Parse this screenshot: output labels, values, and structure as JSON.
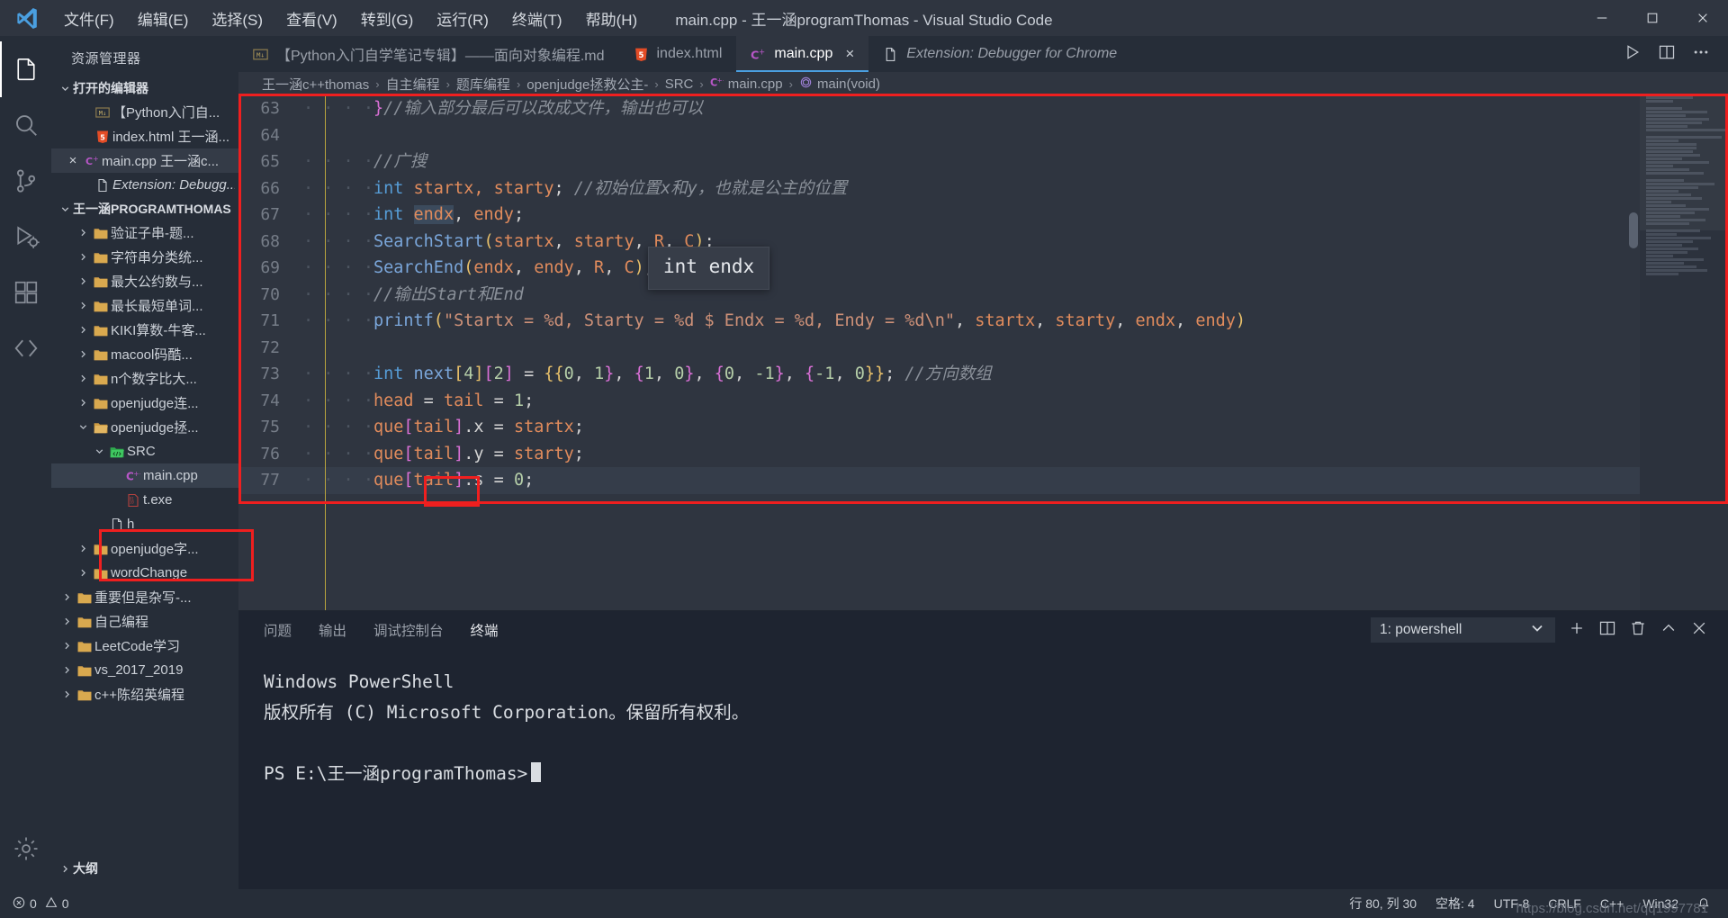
{
  "window": {
    "title": "main.cpp - 王一涵programThomas - Visual Studio Code",
    "logo_icon": "vscode-logo",
    "controls": {
      "minimize": "minimize-icon",
      "maximize": "maximize-icon",
      "close": "close-icon"
    }
  },
  "menubar": {
    "items": [
      {
        "label": "文件(F)",
        "name": "menu-file"
      },
      {
        "label": "编辑(E)",
        "name": "menu-edit"
      },
      {
        "label": "选择(S)",
        "name": "menu-selection"
      },
      {
        "label": "查看(V)",
        "name": "menu-view"
      },
      {
        "label": "转到(G)",
        "name": "menu-go"
      },
      {
        "label": "运行(R)",
        "name": "menu-run"
      },
      {
        "label": "终端(T)",
        "name": "menu-terminal"
      },
      {
        "label": "帮助(H)",
        "name": "menu-help"
      }
    ]
  },
  "activitybar": {
    "items": [
      {
        "icon": "explorer-icon",
        "active": true
      },
      {
        "icon": "search-icon",
        "active": false
      },
      {
        "icon": "source-control-icon",
        "active": false
      },
      {
        "icon": "run-and-debug-icon",
        "active": false
      },
      {
        "icon": "extensions-icon",
        "active": false
      },
      {
        "icon": "remote-explorer-icon",
        "active": false
      }
    ],
    "bottom": [
      {
        "icon": "gear-icon"
      }
    ]
  },
  "sidebar": {
    "title": "资源管理器",
    "open_editors": {
      "label": "打开的编辑器",
      "items": [
        {
          "name": "open-editor-python-md",
          "icon": "markdown-icon",
          "label": "【Python入门自...",
          "dirty": false,
          "active": false
        },
        {
          "name": "open-editor-index-html",
          "icon": "html-icon",
          "label": "index.html 王一涵...",
          "active": false
        },
        {
          "name": "open-editor-main-cpp",
          "icon": "cpp-icon",
          "label": "main.cpp 王一涵c...",
          "active": true,
          "close": "×"
        },
        {
          "name": "open-editor-extension",
          "icon": "file-icon",
          "label": "Extension: Debugg...",
          "italic": true,
          "active": false
        }
      ]
    },
    "workspace": {
      "label": "王一涵PROGRAMTHOMAS",
      "items": [
        {
          "name": "folder-yanzheng",
          "icon": "folder-icon",
          "label": "验证子串-题...",
          "expanded": false,
          "depth": 1
        },
        {
          "name": "folder-zifuchuan",
          "icon": "folder-icon",
          "label": "字符串分类统...",
          "expanded": false,
          "depth": 1
        },
        {
          "name": "folder-zuidagongyueshu",
          "icon": "folder-icon",
          "label": "最大公约数与...",
          "expanded": false,
          "depth": 1
        },
        {
          "name": "folder-zuichang",
          "icon": "folder-icon",
          "label": "最长最短单词...",
          "expanded": false,
          "depth": 1
        },
        {
          "name": "folder-kiki",
          "icon": "folder-icon",
          "label": "KIKI算数-牛客...",
          "expanded": false,
          "depth": 1
        },
        {
          "name": "folder-macool",
          "icon": "folder-icon",
          "label": "macool码酷...",
          "expanded": false,
          "depth": 1
        },
        {
          "name": "folder-ngeshuzi",
          "icon": "folder-icon",
          "label": "n个数字比大...",
          "expanded": false,
          "depth": 1
        },
        {
          "name": "folder-openjudge-lian",
          "icon": "folder-icon",
          "label": "openjudge连...",
          "expanded": false,
          "depth": 1
        },
        {
          "name": "folder-openjudge-zheng",
          "icon": "folder-open-icon",
          "label": "openjudge拯...",
          "expanded": true,
          "depth": 1
        },
        {
          "name": "folder-src",
          "icon": "src-folder-icon",
          "label": "SRC",
          "expanded": true,
          "depth": 2,
          "highlight": true
        },
        {
          "name": "file-main-cpp",
          "icon": "cpp-icon",
          "label": "main.cpp",
          "depth": 3,
          "selected": true
        },
        {
          "name": "file-t-exe",
          "icon": "binary-icon",
          "label": "t.exe",
          "depth": 3
        },
        {
          "name": "file-h",
          "icon": "file-icon",
          "label": "h",
          "depth": 2
        },
        {
          "name": "folder-openjudge-zi",
          "icon": "folder-icon",
          "label": "openjudge字...",
          "expanded": false,
          "depth": 1
        },
        {
          "name": "folder-wordchange",
          "icon": "folder-icon",
          "label": "wordChange",
          "expanded": false,
          "depth": 1
        },
        {
          "name": "folder-zhongyao",
          "icon": "folder-icon",
          "label": "重要但是杂写-...",
          "expanded": false,
          "depth": 0
        },
        {
          "name": "folder-ziji",
          "icon": "folder-icon",
          "label": "自己编程",
          "expanded": false,
          "depth": 0
        },
        {
          "name": "folder-leetcode",
          "icon": "folder-icon",
          "label": "LeetCode学习",
          "expanded": false,
          "depth": 0
        },
        {
          "name": "folder-vs2017",
          "icon": "folder-icon",
          "label": "vs_2017_2019",
          "expanded": false,
          "depth": 0
        },
        {
          "name": "folder-cppchen",
          "icon": "folder-icon",
          "label": "c++陈绍英编程",
          "expanded": false,
          "depth": 0
        }
      ]
    },
    "outline": {
      "label": "大纲"
    }
  },
  "editor": {
    "tabs": [
      {
        "name": "tab-python-md",
        "icon": "markdown-icon",
        "label": "【Python入门自学笔记专辑】——面向对象编程.md",
        "active": false,
        "closable": false
      },
      {
        "name": "tab-index-html",
        "icon": "html-icon",
        "label": "index.html",
        "active": false,
        "closable": false
      },
      {
        "name": "tab-main-cpp",
        "icon": "cpp-icon",
        "label": "main.cpp",
        "active": true,
        "closable": true,
        "close": "×"
      },
      {
        "name": "tab-extension",
        "icon": "file-icon",
        "label": "Extension: Debugger for Chrome",
        "active": false,
        "italic": true,
        "closable": false
      }
    ],
    "actions": [
      {
        "name": "run-code-button",
        "icon": "play-icon"
      },
      {
        "name": "split-editor-button",
        "icon": "split-editor-icon"
      },
      {
        "name": "more-actions-button",
        "icon": "ellipsis-icon"
      }
    ],
    "breadcrumb": [
      {
        "label": "王一涵c++thomas",
        "icon": ""
      },
      {
        "label": "自主编程",
        "icon": ""
      },
      {
        "label": "题库编程",
        "icon": ""
      },
      {
        "label": "openjudge拯救公主-",
        "icon": ""
      },
      {
        "label": "SRC",
        "icon": ""
      },
      {
        "label": "main.cpp",
        "icon": "cpp-icon"
      },
      {
        "label": "main(void)",
        "icon": "method-icon"
      }
    ],
    "hover_tooltip": "int endx",
    "code": [
      {
        "n": "63",
        "tokens": [
          {
            "t": "    ",
            "c": "dot"
          },
          {
            "t": "}",
            "c": "brk2"
          },
          {
            "t": "//输入部分最后可以改成文件，输出也可以",
            "c": "com"
          }
        ]
      },
      {
        "n": "64",
        "tokens": []
      },
      {
        "n": "65",
        "tokens": [
          {
            "t": "    ",
            "c": "dot"
          },
          {
            "t": "//广搜",
            "c": "com"
          }
        ]
      },
      {
        "n": "66",
        "tokens": [
          {
            "t": "    ",
            "c": "dot"
          },
          {
            "t": "int",
            "c": "type"
          },
          {
            "t": " startx, starty",
            "c": "var"
          },
          {
            "t": ";",
            "c": "punc"
          },
          {
            "t": " //初始位置x和y，也就是公主的位置",
            "c": "com"
          }
        ]
      },
      {
        "n": "67",
        "tokens": [
          {
            "t": "    ",
            "c": "dot"
          },
          {
            "t": "int",
            "c": "type"
          },
          {
            "t": " ",
            "c": "punc"
          },
          {
            "t": "endx",
            "c": "var sel"
          },
          {
            "t": ", ",
            "c": "punc"
          },
          {
            "t": "endy",
            "c": "var"
          },
          {
            "t": ";",
            "c": "punc"
          }
        ]
      },
      {
        "n": "68",
        "tokens": [
          {
            "t": "    ",
            "c": "dot"
          },
          {
            "t": "SearchStart",
            "c": "fn"
          },
          {
            "t": "(",
            "c": "brk1"
          },
          {
            "t": "startx",
            "c": "var"
          },
          {
            "t": ", ",
            "c": "punc"
          },
          {
            "t": "starty",
            "c": "var"
          },
          {
            "t": ", ",
            "c": "punc"
          },
          {
            "t": "R",
            "c": "var"
          },
          {
            "t": ", ",
            "c": "punc"
          },
          {
            "t": "C",
            "c": "var"
          },
          {
            "t": ")",
            "c": "brk1"
          },
          {
            "t": ";",
            "c": "punc"
          }
        ]
      },
      {
        "n": "69",
        "tokens": [
          {
            "t": "    ",
            "c": "dot"
          },
          {
            "t": "SearchEnd",
            "c": "fn"
          },
          {
            "t": "(",
            "c": "brk1"
          },
          {
            "t": "endx",
            "c": "var"
          },
          {
            "t": ", ",
            "c": "punc"
          },
          {
            "t": "endy",
            "c": "var"
          },
          {
            "t": ", ",
            "c": "punc"
          },
          {
            "t": "R",
            "c": "var"
          },
          {
            "t": ", ",
            "c": "punc"
          },
          {
            "t": "C",
            "c": "var"
          },
          {
            "t": ")",
            "c": "brk1"
          },
          {
            "t": ";",
            "c": "punc"
          }
        ]
      },
      {
        "n": "70",
        "tokens": [
          {
            "t": "    ",
            "c": "dot"
          },
          {
            "t": "//输出Start和End",
            "c": "com"
          }
        ]
      },
      {
        "n": "71",
        "tokens": [
          {
            "t": "    ",
            "c": "dot"
          },
          {
            "t": "printf",
            "c": "fn"
          },
          {
            "t": "(",
            "c": "brk1"
          },
          {
            "t": "\"Startx = %d, Starty = %d $ Endx = %d, Endy = %d\\n\"",
            "c": "str"
          },
          {
            "t": ", ",
            "c": "punc"
          },
          {
            "t": "startx",
            "c": "var"
          },
          {
            "t": ", ",
            "c": "punc"
          },
          {
            "t": "starty",
            "c": "var"
          },
          {
            "t": ", ",
            "c": "punc"
          },
          {
            "t": "endx",
            "c": "var"
          },
          {
            "t": ", ",
            "c": "punc"
          },
          {
            "t": "endy",
            "c": "var"
          },
          {
            "t": ")",
            "c": "brk1"
          }
        ]
      },
      {
        "n": "72",
        "tokens": []
      },
      {
        "n": "73",
        "tokens": [
          {
            "t": "    ",
            "c": "dot"
          },
          {
            "t": "int",
            "c": "type"
          },
          {
            "t": " ",
            "c": "punc"
          },
          {
            "t": "next",
            "c": "fn"
          },
          {
            "t": "[",
            "c": "brk1"
          },
          {
            "t": "4",
            "c": "num"
          },
          {
            "t": "]",
            "c": "brk1"
          },
          {
            "t": "[",
            "c": "brk2"
          },
          {
            "t": "2",
            "c": "num"
          },
          {
            "t": "]",
            "c": "brk2"
          },
          {
            "t": " = ",
            "c": "punc"
          },
          {
            "t": "{{",
            "c": "brk1"
          },
          {
            "t": "0",
            "c": "num"
          },
          {
            "t": ", ",
            "c": "punc"
          },
          {
            "t": "1",
            "c": "num"
          },
          {
            "t": "}",
            "c": "brk2"
          },
          {
            "t": ", ",
            "c": "punc"
          },
          {
            "t": "{",
            "c": "brk2"
          },
          {
            "t": "1",
            "c": "num"
          },
          {
            "t": ", ",
            "c": "punc"
          },
          {
            "t": "0",
            "c": "num"
          },
          {
            "t": "}",
            "c": "brk2"
          },
          {
            "t": ", ",
            "c": "punc"
          },
          {
            "t": "{",
            "c": "brk2"
          },
          {
            "t": "0",
            "c": "num"
          },
          {
            "t": ", ",
            "c": "punc"
          },
          {
            "t": "-1",
            "c": "num"
          },
          {
            "t": "}",
            "c": "brk2"
          },
          {
            "t": ", ",
            "c": "punc"
          },
          {
            "t": "{",
            "c": "brk2"
          },
          {
            "t": "-1",
            "c": "num"
          },
          {
            "t": ", ",
            "c": "punc"
          },
          {
            "t": "0",
            "c": "num"
          },
          {
            "t": "}}",
            "c": "brk1"
          },
          {
            "t": ";",
            "c": "punc"
          },
          {
            "t": " //方向数组",
            "c": "com"
          }
        ]
      },
      {
        "n": "74",
        "tokens": [
          {
            "t": "    ",
            "c": "dot"
          },
          {
            "t": "head",
            "c": "var"
          },
          {
            "t": " = ",
            "c": "punc"
          },
          {
            "t": "tail",
            "c": "var"
          },
          {
            "t": " = ",
            "c": "punc"
          },
          {
            "t": "1",
            "c": "num"
          },
          {
            "t": ";",
            "c": "punc"
          }
        ]
      },
      {
        "n": "75",
        "tokens": [
          {
            "t": "    ",
            "c": "dot"
          },
          {
            "t": "que",
            "c": "var"
          },
          {
            "t": "[",
            "c": "brk2"
          },
          {
            "t": "tail",
            "c": "var"
          },
          {
            "t": "]",
            "c": "brk2"
          },
          {
            "t": ".x",
            "c": "punc"
          },
          {
            "t": " = ",
            "c": "punc"
          },
          {
            "t": "startx",
            "c": "var"
          },
          {
            "t": ";",
            "c": "punc"
          }
        ]
      },
      {
        "n": "76",
        "tokens": [
          {
            "t": "    ",
            "c": "dot"
          },
          {
            "t": "que",
            "c": "var"
          },
          {
            "t": "[",
            "c": "brk2"
          },
          {
            "t": "tail",
            "c": "var"
          },
          {
            "t": "]",
            "c": "brk2"
          },
          {
            "t": ".y",
            "c": "punc"
          },
          {
            "t": " = ",
            "c": "punc"
          },
          {
            "t": "starty",
            "c": "var"
          },
          {
            "t": ";",
            "c": "punc"
          }
        ]
      },
      {
        "n": "77",
        "tokens": [
          {
            "t": "    ",
            "c": "dot"
          },
          {
            "t": "que",
            "c": "var"
          },
          {
            "t": "[",
            "c": "brk2"
          },
          {
            "t": "tail",
            "c": "var"
          },
          {
            "t": "]",
            "c": "brk2"
          },
          {
            "t": ".s",
            "c": "punc"
          },
          {
            "t": " = ",
            "c": "punc"
          },
          {
            "t": "0",
            "c": "num"
          },
          {
            "t": ";",
            "c": "punc"
          }
        ],
        "highlight": true
      }
    ]
  },
  "panel": {
    "tabs": [
      {
        "name": "panel-tab-problems",
        "label": "问题",
        "active": false
      },
      {
        "name": "panel-tab-output",
        "label": "输出",
        "active": false
      },
      {
        "name": "panel-tab-debug-console",
        "label": "调试控制台",
        "active": false
      },
      {
        "name": "panel-tab-terminal",
        "label": "终端",
        "active": true
      }
    ],
    "terminal_select": {
      "value": "1: powershell",
      "chevron": "chevron-down-icon"
    },
    "actions": [
      {
        "name": "new-terminal-button",
        "icon": "plus-icon"
      },
      {
        "name": "split-terminal-button",
        "icon": "split-icon"
      },
      {
        "name": "kill-terminal-button",
        "icon": "trash-icon"
      },
      {
        "name": "maximize-panel-button",
        "icon": "chevron-up-icon"
      },
      {
        "name": "close-panel-button",
        "icon": "close-icon"
      }
    ],
    "terminal_lines": [
      "Windows PowerShell",
      "版权所有 (C) Microsoft Corporation。保留所有权利。",
      "",
      "PS E:\\王一涵programThomas>"
    ]
  },
  "statusbar": {
    "left": [
      {
        "name": "status-errors",
        "icon": "error-icon",
        "label": "0"
      },
      {
        "name": "status-warnings",
        "icon": "warning-icon",
        "label": "0"
      }
    ],
    "right": [
      {
        "name": "status-line-col",
        "label": "行 80, 列 30"
      },
      {
        "name": "status-indent",
        "label": "空格: 4"
      },
      {
        "name": "status-encoding",
        "label": "UTF-8"
      },
      {
        "name": "status-eol",
        "label": "CRLF"
      },
      {
        "name": "status-language",
        "label": "C++"
      },
      {
        "name": "status-win32",
        "label": "Win32"
      },
      {
        "name": "status-bell",
        "label": ""
      }
    ]
  },
  "annotations": {
    "watermark": "https://blog.csdn.net/qq1997781"
  },
  "colors": {
    "accent": "#4a9fe0",
    "annotation_red": "#ef1f1f",
    "titlebar_bg": "#2f3540",
    "sidebar_bg": "#262d38",
    "editor_bg": "#2f3540",
    "panel_bg": "#1e2430"
  }
}
